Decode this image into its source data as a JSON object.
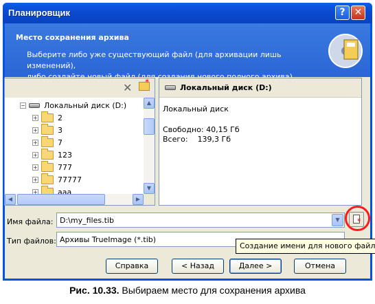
{
  "window": {
    "title": "Планировщик",
    "help_glyph": "?",
    "close_glyph": "✕"
  },
  "header": {
    "title": "Место сохранения архива",
    "description_line1": "Выберите либо уже существующий файл (для архивации лишь изменений),",
    "description_line2": "либо создайте новый файл (для создания нового полного архива)."
  },
  "toolbar": {
    "delete_icon": "✕"
  },
  "tree": {
    "root": {
      "label": "Локальный диск (D:)",
      "expander": "−"
    },
    "items": [
      {
        "label": "2",
        "expander": "+"
      },
      {
        "label": "3",
        "expander": "+"
      },
      {
        "label": "7",
        "expander": "+"
      },
      {
        "label": "123",
        "expander": "+"
      },
      {
        "label": "777",
        "expander": "+"
      },
      {
        "label": "77777",
        "expander": "+"
      },
      {
        "label": "aaa",
        "expander": "+"
      }
    ]
  },
  "scroll": {
    "up": "▲",
    "down": "▼",
    "left": "◀",
    "right": "▶"
  },
  "info": {
    "heading": "Локальный диск (D:)",
    "type": "Локальный диск",
    "free": "Свободно: 40,15 Гб",
    "total": "Всего:    139,3 Гб"
  },
  "form": {
    "filename_label": "Имя файла:",
    "filename_value": "D:\\my_files.tib",
    "filetype_label": "Тип файлов:",
    "filetype_value": "Архивы TrueImage (*.tib)",
    "combo_arrow": "▼"
  },
  "tooltip": "Создание имени для нового файла",
  "buttons": {
    "help": "Справка",
    "back": "< Назад",
    "next": "Далее >",
    "cancel": "Отмена"
  },
  "caption": {
    "label": "Рис. 10.33.",
    "text": " Выбираем место для сохранения архива"
  },
  "colors": {
    "title_bar": "#0a4bd2",
    "header": "#2f6dd9",
    "highlight_ring": "#ff1a1a"
  }
}
